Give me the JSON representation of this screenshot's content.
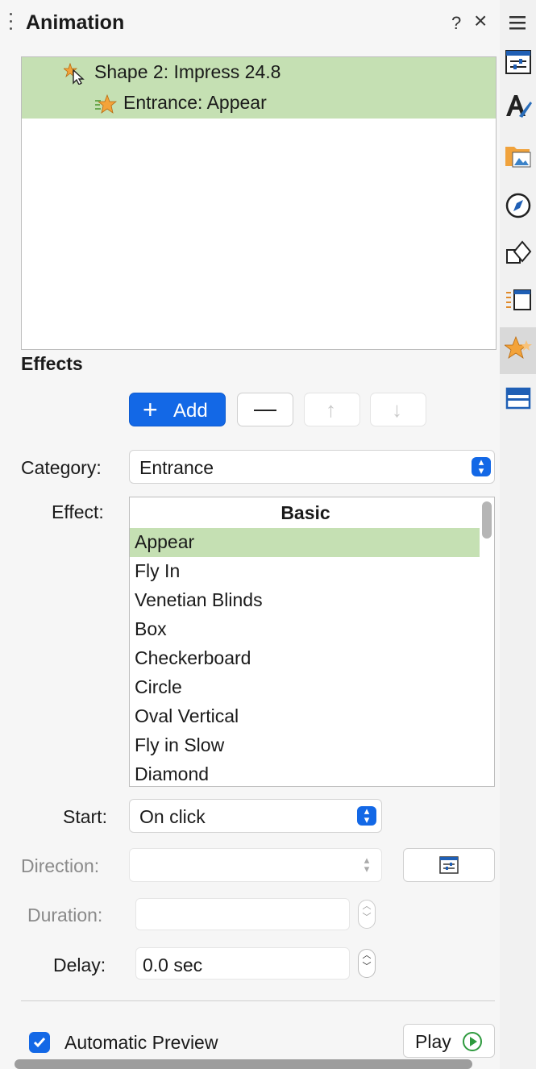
{
  "panel": {
    "title": "Animation",
    "help_label": "?",
    "close_label": "×"
  },
  "animation_list": [
    {
      "label": "Shape 2: Impress 24.8",
      "icon": "shape-cursor-icon"
    },
    {
      "label": "Entrance: Appear",
      "icon": "entrance-star-icon"
    }
  ],
  "effects": {
    "title": "Effects",
    "add_label": "Add",
    "add_icon": "plus-icon",
    "remove_icon": "minus-icon",
    "move_up_icon": "arrow-up-icon",
    "move_down_icon": "arrow-down-icon"
  },
  "form": {
    "category_label": "Category:",
    "category_value": "Entrance",
    "effect_label": "Effect:",
    "effect_group": "Basic",
    "effect_items": [
      "Appear",
      "Fly In",
      "Venetian Blinds",
      "Box",
      "Checkerboard",
      "Circle",
      "Oval Vertical",
      "Fly in Slow",
      "Diamond"
    ],
    "effect_selected": "Appear",
    "start_label": "Start:",
    "start_value": "On click",
    "direction_label": "Direction:",
    "direction_value": "",
    "duration_label": "Duration:",
    "duration_value": "",
    "delay_label": "Delay:",
    "delay_value": "0.0 sec"
  },
  "preview": {
    "automatic_label": "Automatic Preview",
    "automatic_checked": true,
    "play_label": "Play"
  },
  "sidebar_icons": [
    "menu-icon",
    "properties-icon",
    "styles-icon",
    "gallery-icon",
    "navigator-icon",
    "shapes-icon",
    "slide-transition-icon",
    "animation-icon",
    "master-slides-icon"
  ],
  "colors": {
    "accent": "#1368e6",
    "selection": "#c5e0b3"
  }
}
